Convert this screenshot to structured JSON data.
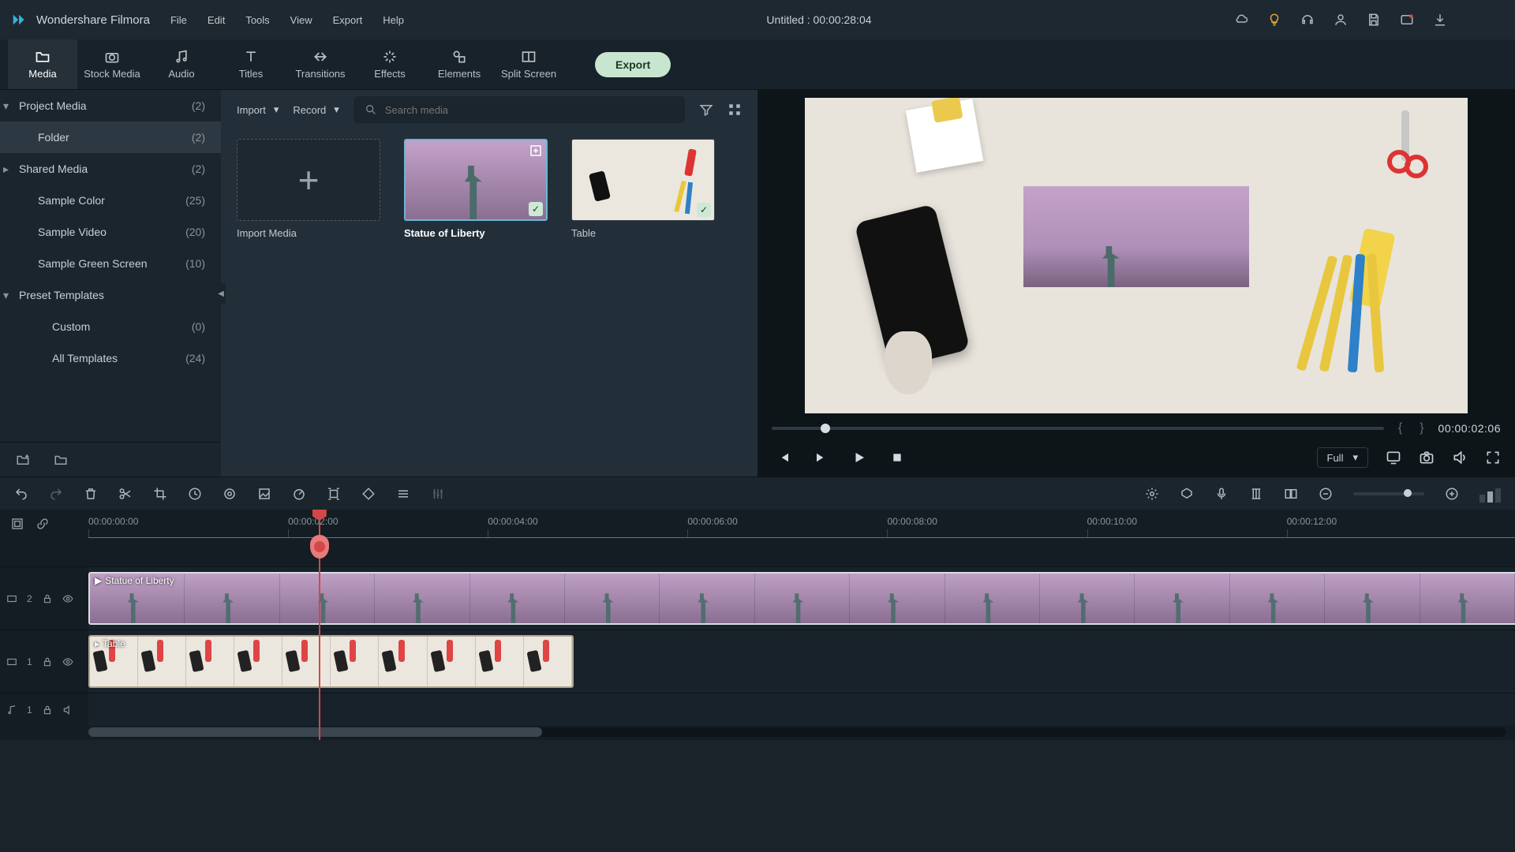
{
  "app": {
    "name": "Wondershare Filmora",
    "project_title": "Untitled : 00:00:28:04"
  },
  "menus": [
    "File",
    "Edit",
    "Tools",
    "View",
    "Export",
    "Help"
  ],
  "tabs": [
    {
      "id": "media",
      "label": "Media",
      "active": true
    },
    {
      "id": "stock",
      "label": "Stock Media"
    },
    {
      "id": "audio",
      "label": "Audio"
    },
    {
      "id": "titles",
      "label": "Titles"
    },
    {
      "id": "transitions",
      "label": "Transitions"
    },
    {
      "id": "effects",
      "label": "Effects"
    },
    {
      "id": "elements",
      "label": "Elements"
    },
    {
      "id": "split",
      "label": "Split Screen"
    }
  ],
  "export_label": "Export",
  "sidebar": [
    {
      "label": "Project Media",
      "count": "(2)",
      "expandable": true,
      "open": true
    },
    {
      "label": "Folder",
      "count": "(2)",
      "level": 1,
      "selected": true
    },
    {
      "label": "Shared Media",
      "count": "(2)",
      "expandable": true
    },
    {
      "label": "Sample Color",
      "count": "(25)",
      "level": 1
    },
    {
      "label": "Sample Video",
      "count": "(20)",
      "level": 1
    },
    {
      "label": "Sample Green Screen",
      "count": "(10)",
      "level": 1
    },
    {
      "label": "Preset Templates",
      "count": "",
      "expandable": true,
      "open": true
    },
    {
      "label": "Custom",
      "count": "(0)",
      "level": 2
    },
    {
      "label": "All Templates",
      "count": "(24)",
      "level": 2
    }
  ],
  "media_toolbar": {
    "import": "Import",
    "record": "Record",
    "search_placeholder": "Search media"
  },
  "media_items": {
    "import_label": "Import Media",
    "item1_label": "Statue of Liberty",
    "item2_label": "Table"
  },
  "preview": {
    "timecode": "00:00:02:06",
    "quality": "Full"
  },
  "ruler_ticks": [
    "00:00:00:00",
    "00:00:02:00",
    "00:00:04:00",
    "00:00:06:00",
    "00:00:08:00",
    "00:00:10:00",
    "00:00:12:00"
  ],
  "tracks": {
    "v2": "2",
    "v1": "1",
    "a1": "1",
    "clip1_label": "Statue of Liberty",
    "clip2_label": "Table"
  }
}
